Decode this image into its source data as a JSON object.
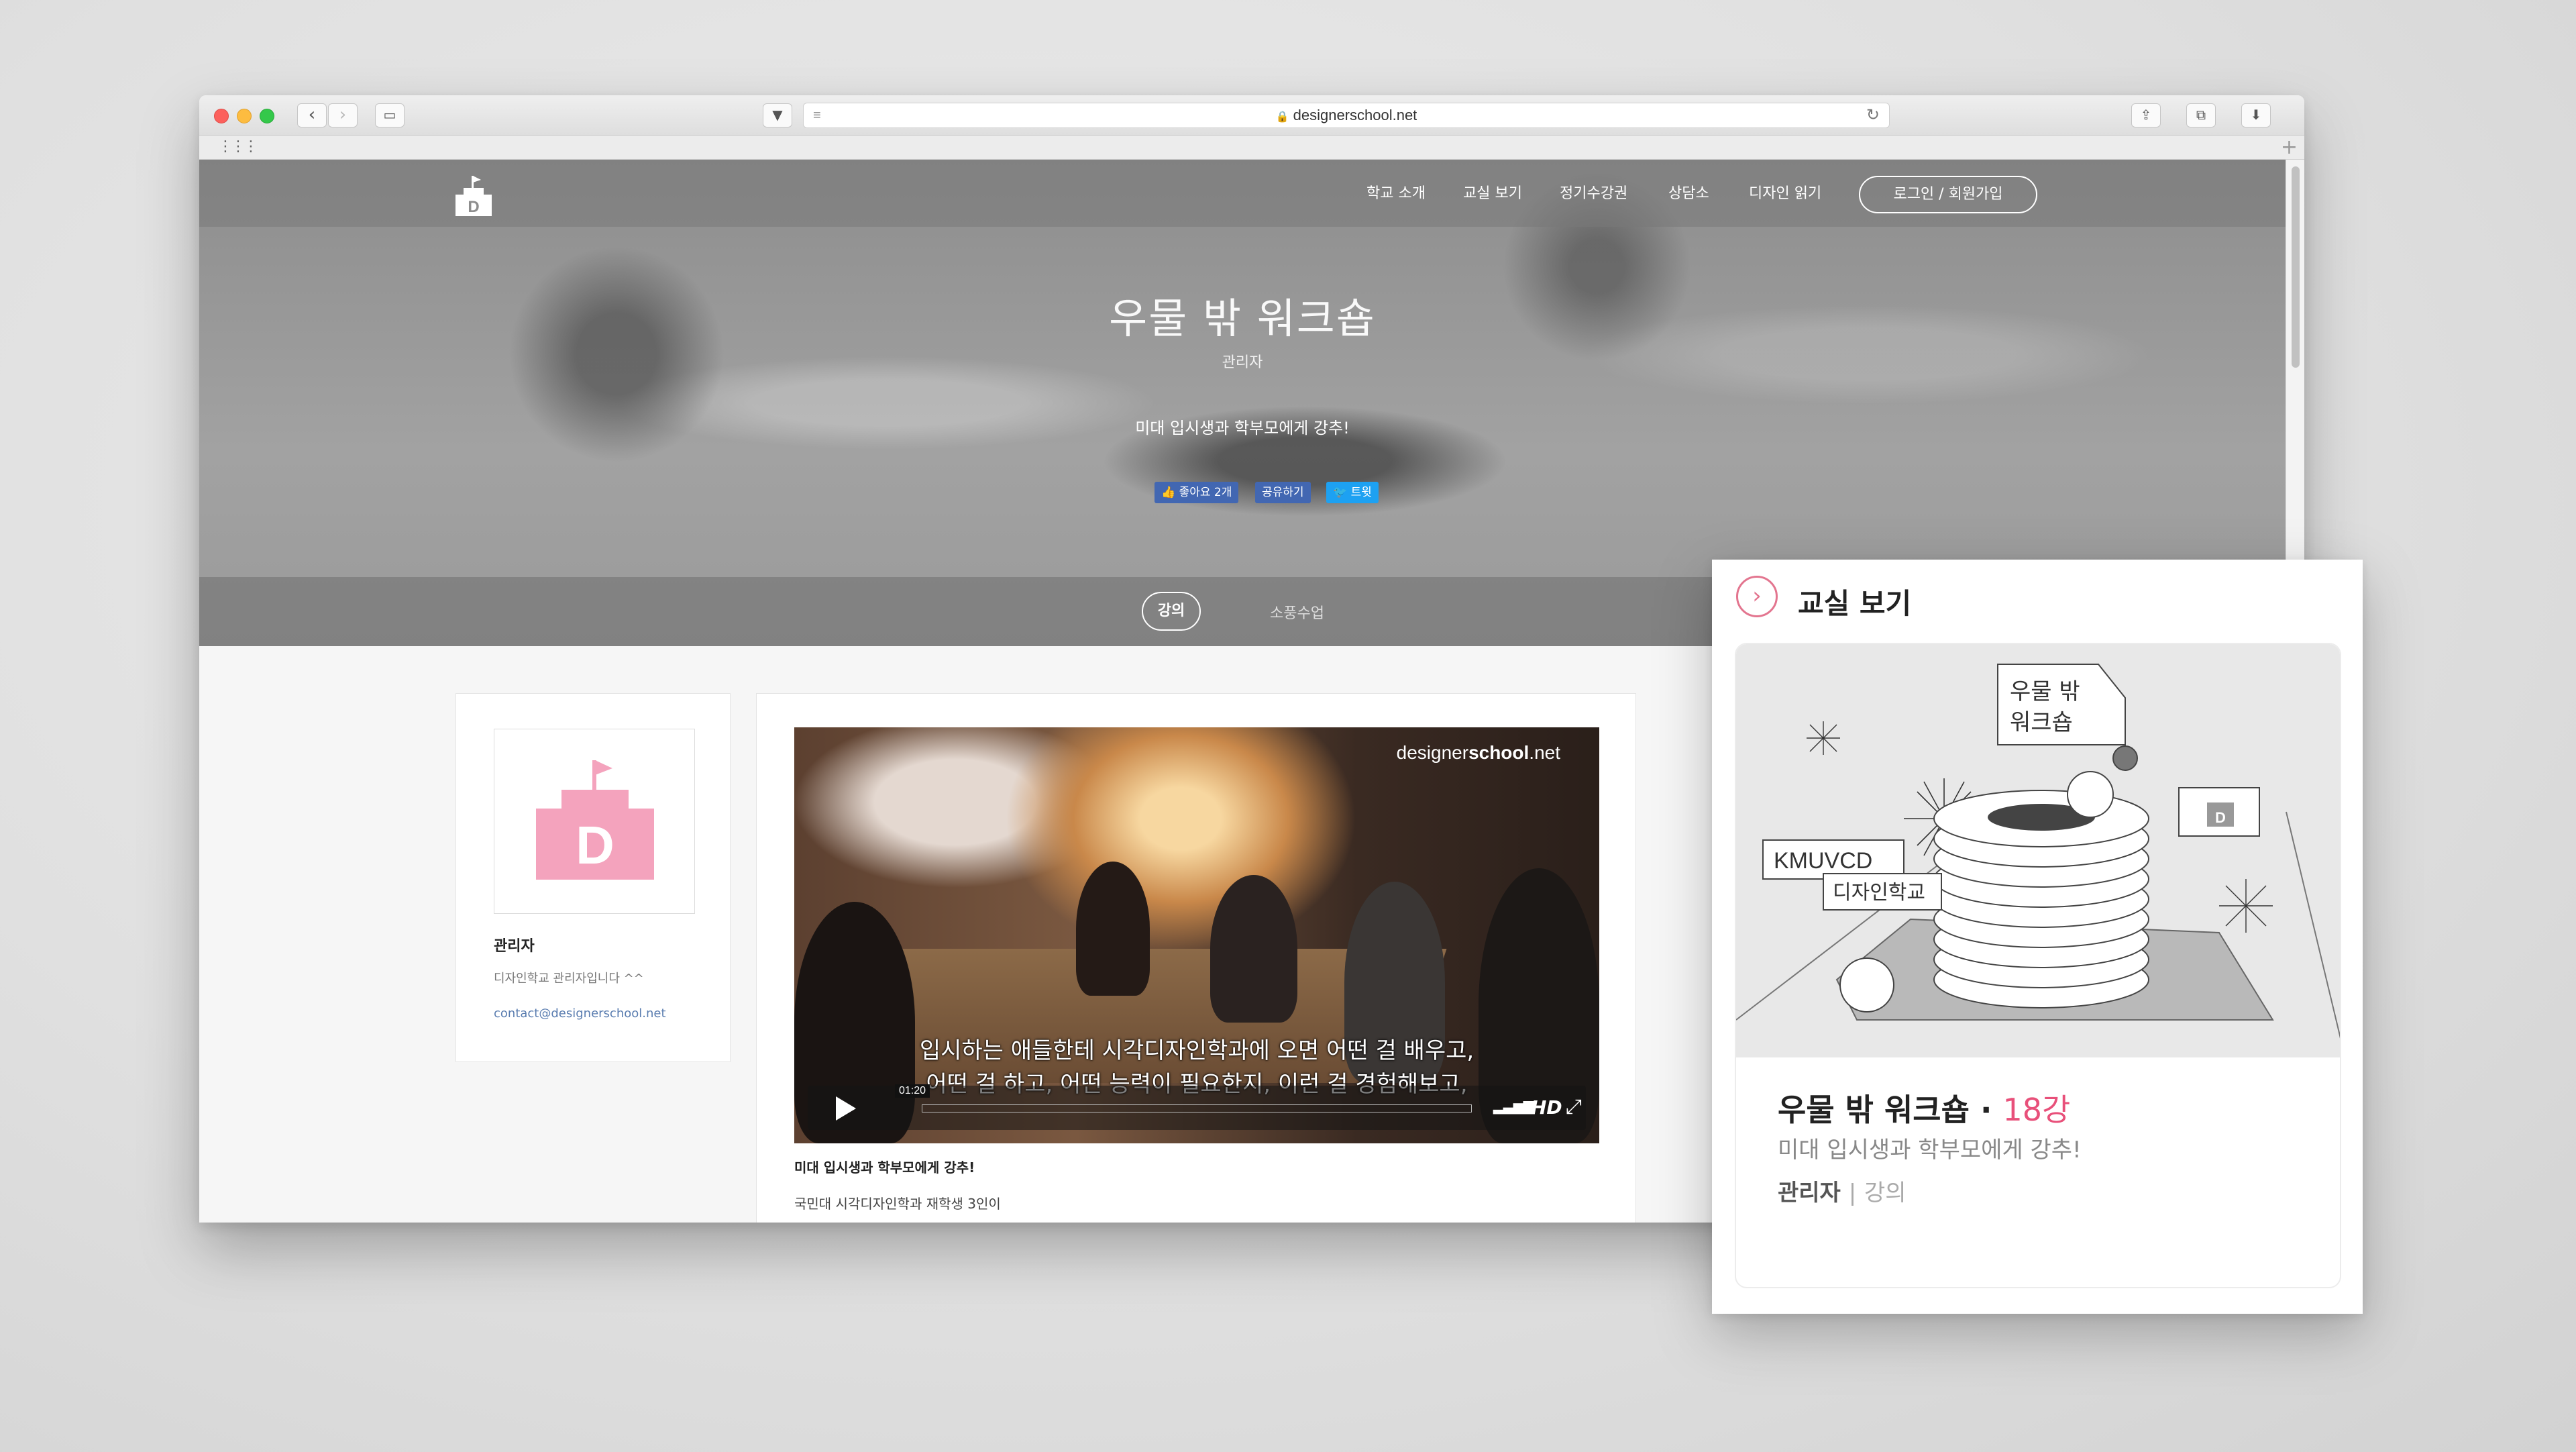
{
  "browser": {
    "url": "designerschool.net"
  },
  "site": {
    "nav": [
      "학교 소개",
      "교실 보기",
      "정기수강권",
      "상담소",
      "디자인 읽기"
    ],
    "login_label": "로그인 / 회원가입",
    "logo_letter": "D"
  },
  "hero": {
    "title": "우물 밖 워크숍",
    "author": "관리자",
    "description": "미대 입시생과 학부모에게 강추!",
    "share": {
      "like": "좋아요 2개",
      "share": "공유하기",
      "tweet": "트윗"
    },
    "tabs": [
      "강의",
      "소풍수업"
    ]
  },
  "profile": {
    "name": "관리자",
    "bio": "디자인학교 관리자입니다 ^^",
    "email": "contact@designerschool.net"
  },
  "video": {
    "watermark_plain": "designer",
    "watermark_bold": "school",
    "watermark_suffix": ".net",
    "subtitle_line1": "입시하는 애들한테 시각디자인학과에 오면 어떤 걸 배우고,",
    "subtitle_line2": "어떤 걸 하고, 어떤 능력이 필요한지, 이런 걸 경험해보고,",
    "time": "01:20",
    "hd_label": "HD",
    "caption": "미대 입시생과 학부모에게 강추!",
    "text": "국민대 시각디자인학과 재학생 3인이"
  },
  "popup": {
    "title": "교실 보기",
    "illustration": {
      "tag1": "우물 밖",
      "tag2": "워크숍",
      "label_school": "KMUVCD",
      "label_design": "디자인학교",
      "logo_letter": "D"
    },
    "course_title": "우물 밖 워크숍",
    "course_dot": "·",
    "course_count": "18강",
    "course_sub": "미대 입시생과 학부모에게 강추!",
    "course_author": "관리자",
    "course_sep": "|",
    "course_kind": "강의"
  },
  "colors": {
    "accent_pink": "#e8507a",
    "logo_pink": "#f4a3bd",
    "facebook": "#4267b2",
    "twitter": "#1da1f2"
  }
}
